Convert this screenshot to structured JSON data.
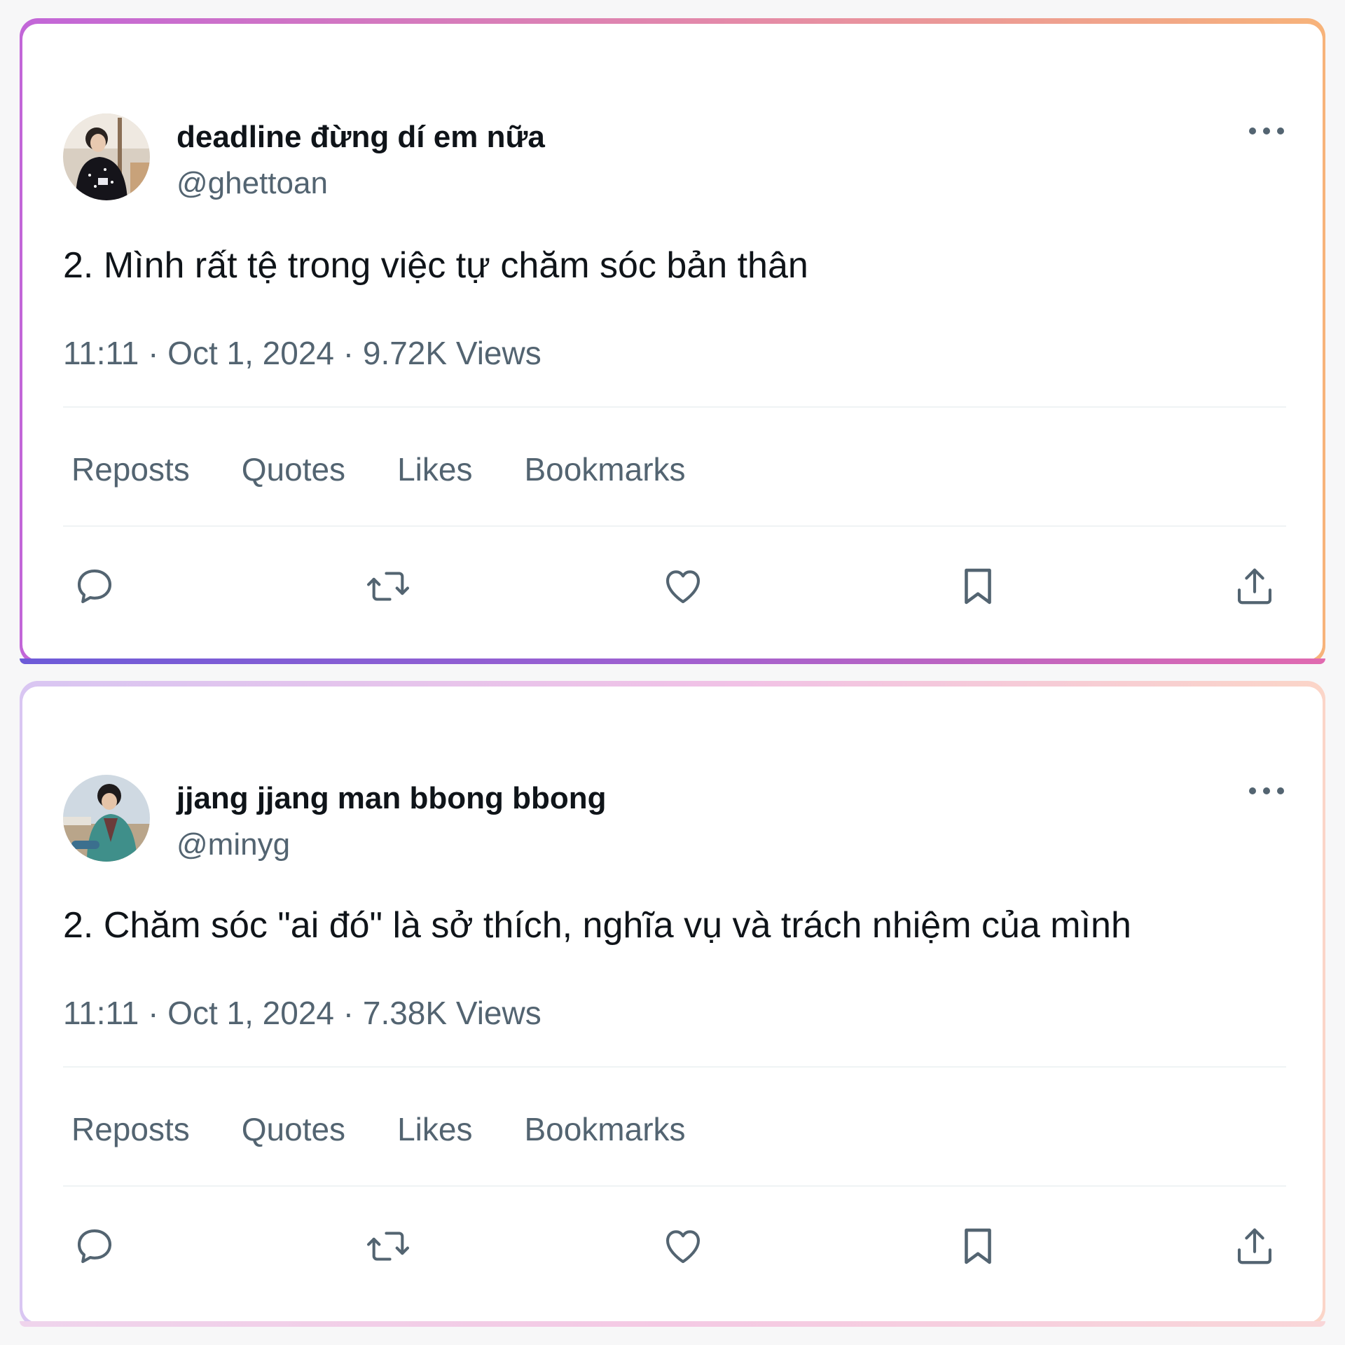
{
  "tweets": [
    {
      "author": {
        "display_name": "deadline đừng dí em nữa",
        "handle": "@ghettoan"
      },
      "text": "2. Mình rất tệ trong việc tự chăm sóc bản thân",
      "meta": "11:11 · Oct 1, 2024 · 9.72K Views",
      "stats": {
        "reposts": "Reposts",
        "quotes": "Quotes",
        "likes": "Likes",
        "bookmarks": "Bookmarks"
      },
      "frame_colors": [
        "#c266d8",
        "#e48aa8",
        "#f7b37a"
      ]
    },
    {
      "author": {
        "display_name": "jjang jjang man bbong bbong",
        "handle": "@minyg"
      },
      "text": "2. Chăm sóc \"ai đó\" là sở thích, nghĩa vụ và trách nhiệm của mình",
      "meta": "11:11 · Oct 1, 2024 · 7.38K Views",
      "stats": {
        "reposts": "Reposts",
        "quotes": "Quotes",
        "likes": "Likes",
        "bookmarks": "Bookmarks"
      },
      "frame_colors": [
        "#d9c6f2",
        "#f1c2e6",
        "#fbd5c8"
      ]
    }
  ],
  "icons": {
    "more": "more-horizontal-icon",
    "reply": "reply-icon",
    "repost": "repost-icon",
    "like": "heart-icon",
    "bookmark": "bookmark-icon",
    "share": "share-icon"
  },
  "colors": {
    "text_primary": "#0f1419",
    "text_secondary": "#536471",
    "divider": "#eff3f4"
  }
}
